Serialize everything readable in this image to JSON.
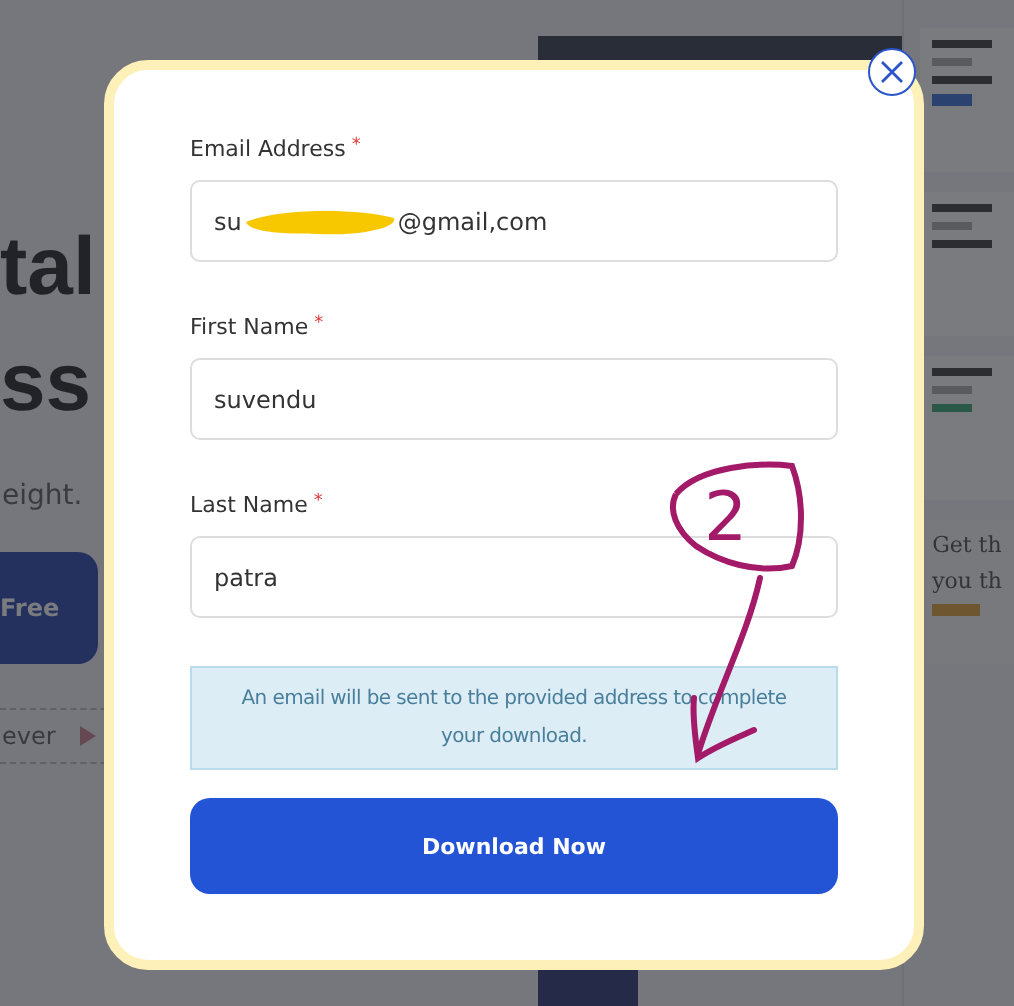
{
  "background_page": {
    "headline_lines": [
      "tal",
      "ss"
    ],
    "subtitle": "eight.",
    "cta_button": "Free",
    "feature_text": "ever",
    "side_card": {
      "lines": [
        "Get th",
        "you th"
      ]
    }
  },
  "modal": {
    "fields": [
      {
        "label": "Email Address",
        "required": true,
        "value_start": "su",
        "value_end": "@gmail,com",
        "redacted": true
      },
      {
        "label": "First Name",
        "required": true,
        "value_start": "suvendu",
        "redacted": false
      },
      {
        "label": "Last Name",
        "required": true,
        "value_start": "patra",
        "redacted": false
      }
    ],
    "required_mark": "*",
    "notice": "An email will be sent to the provided address to complete your download.",
    "submit_button": "Download Now"
  },
  "annotation": {
    "number": "2"
  }
}
